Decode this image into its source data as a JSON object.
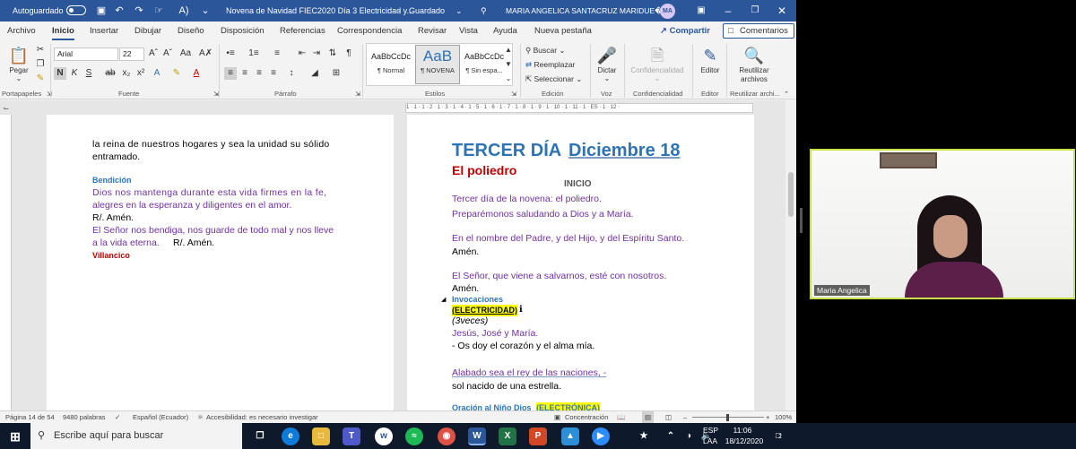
{
  "titlebar": {
    "autosave_label": "Autoguardado",
    "doc_title": "Novena de Navidad FIEC2020 Día 3 Electricidad y...",
    "saved_status": "Guardado",
    "user_name": "MARIA ANGELICA SANTACRUZ MARIDUE�A",
    "user_initials": "MA"
  },
  "tabs": [
    "Archivo",
    "Inicio",
    "Insertar",
    "Dibujar",
    "Diseño",
    "Disposición",
    "Referencias",
    "Correspondencia",
    "Revisar",
    "Vista",
    "Ayuda",
    "Nueva pestaña"
  ],
  "active_tab": "Inicio",
  "share_label": "Compartir",
  "comments_label": "Comentarios",
  "ribbon": {
    "paste_label": "Pegar",
    "clipboard_label": "Portapapeles",
    "font_name": "Arial",
    "font_size": "22",
    "font_group_label": "Fuente",
    "paragraph_label": "Párrafo",
    "styles": [
      {
        "preview": "AaBbCcDc",
        "name": "¶ Normal"
      },
      {
        "preview": "AaB",
        "name": "¶ NOVENA"
      },
      {
        "preview": "AaBbCcDc",
        "name": "¶ Sin espa..."
      }
    ],
    "styles_label": "Estilos",
    "find_label": "Buscar",
    "replace_label": "Reemplazar",
    "select_label": "Seleccionar",
    "editing_label": "Edición",
    "dictate_label": "Dictar",
    "voice_label": "Voz",
    "sensitivity_label": "Confidencialidad",
    "sensitivity_group": "Confidencialidad",
    "editor_label": "Editor",
    "editor_group": "Editor",
    "reuse_label": "Reutilizar archivos",
    "reuse_group": "Reutilizar archi..."
  },
  "left_page": {
    "line1": "la reina de nuestros hogares y sea la unidad su sólido",
    "line2": "entramado.",
    "heading_bendicion": "Bendición",
    "p1a": "Dios nos mantenga durante esta vida firmes en la fe,",
    "p1b": "alegres en la esperanza y diligentes en el amor.",
    "r1": "R/. Amén.",
    "p2a": "El Señor nos bendiga, nos guarde de todo mal y nos lleve",
    "p2b": "a la vida eterna.",
    "r2": "R/. Amén.",
    "villancico": "Villancico"
  },
  "right_page": {
    "title_day": "TERCER DÍA",
    "title_date": "Diciembre 18",
    "subtitle": "El poliedro",
    "inicio": "INICIO",
    "l1": "Tercer día de la novena: el poliedro.",
    "l2": "Preparémonos saludando a Dios y a María.",
    "l3": "En el nombre del Padre, y del Hijo, y del Espíritu Santo.",
    "amen1": "Amén.",
    "l4": "El Señor, que viene a salvarnos, esté con nosotros.",
    "amen2": "Amén.",
    "invocaciones": "Invocaciones",
    "electricidad": "(ELECTRICIDAD)",
    "tres_veces": "(3veces)",
    "jjm": "Jesús, José y María.",
    "os_doy": "- Os doy el corazón y el alma mía.",
    "alabado": "Alabado sea el rey de las naciones,  -",
    "sol": "sol nacido de una estrella.",
    "oracion": "Oración al Niño Dios",
    "electronica": "(ELECTRÓNICA)"
  },
  "ruler_text": "1 · 1 · 1 · 2 · 1 · 3 · 1 · 4 · 1 · 5 · 1 · 6 · 1 · 7 · 1 · 8 · 1 · 9 · 1 · 10 · 1 · 11 · 1 · ES · 1 · 12 ·",
  "status": {
    "page": "Página 14 de 54",
    "words": "9480 palabras",
    "language": "Español (Ecuador)",
    "accessibility": "Accesibilidad: es necesario investigar",
    "focus": "Concentración",
    "zoom": "100%"
  },
  "video": {
    "participant_name": "Maria Angelica"
  },
  "taskbar": {
    "search_placeholder": "Escribe aquí para buscar",
    "lang_top": "ESP",
    "lang_bottom": "LAA",
    "time": "11:06",
    "date": "18/12/2020",
    "notifications": "2"
  }
}
